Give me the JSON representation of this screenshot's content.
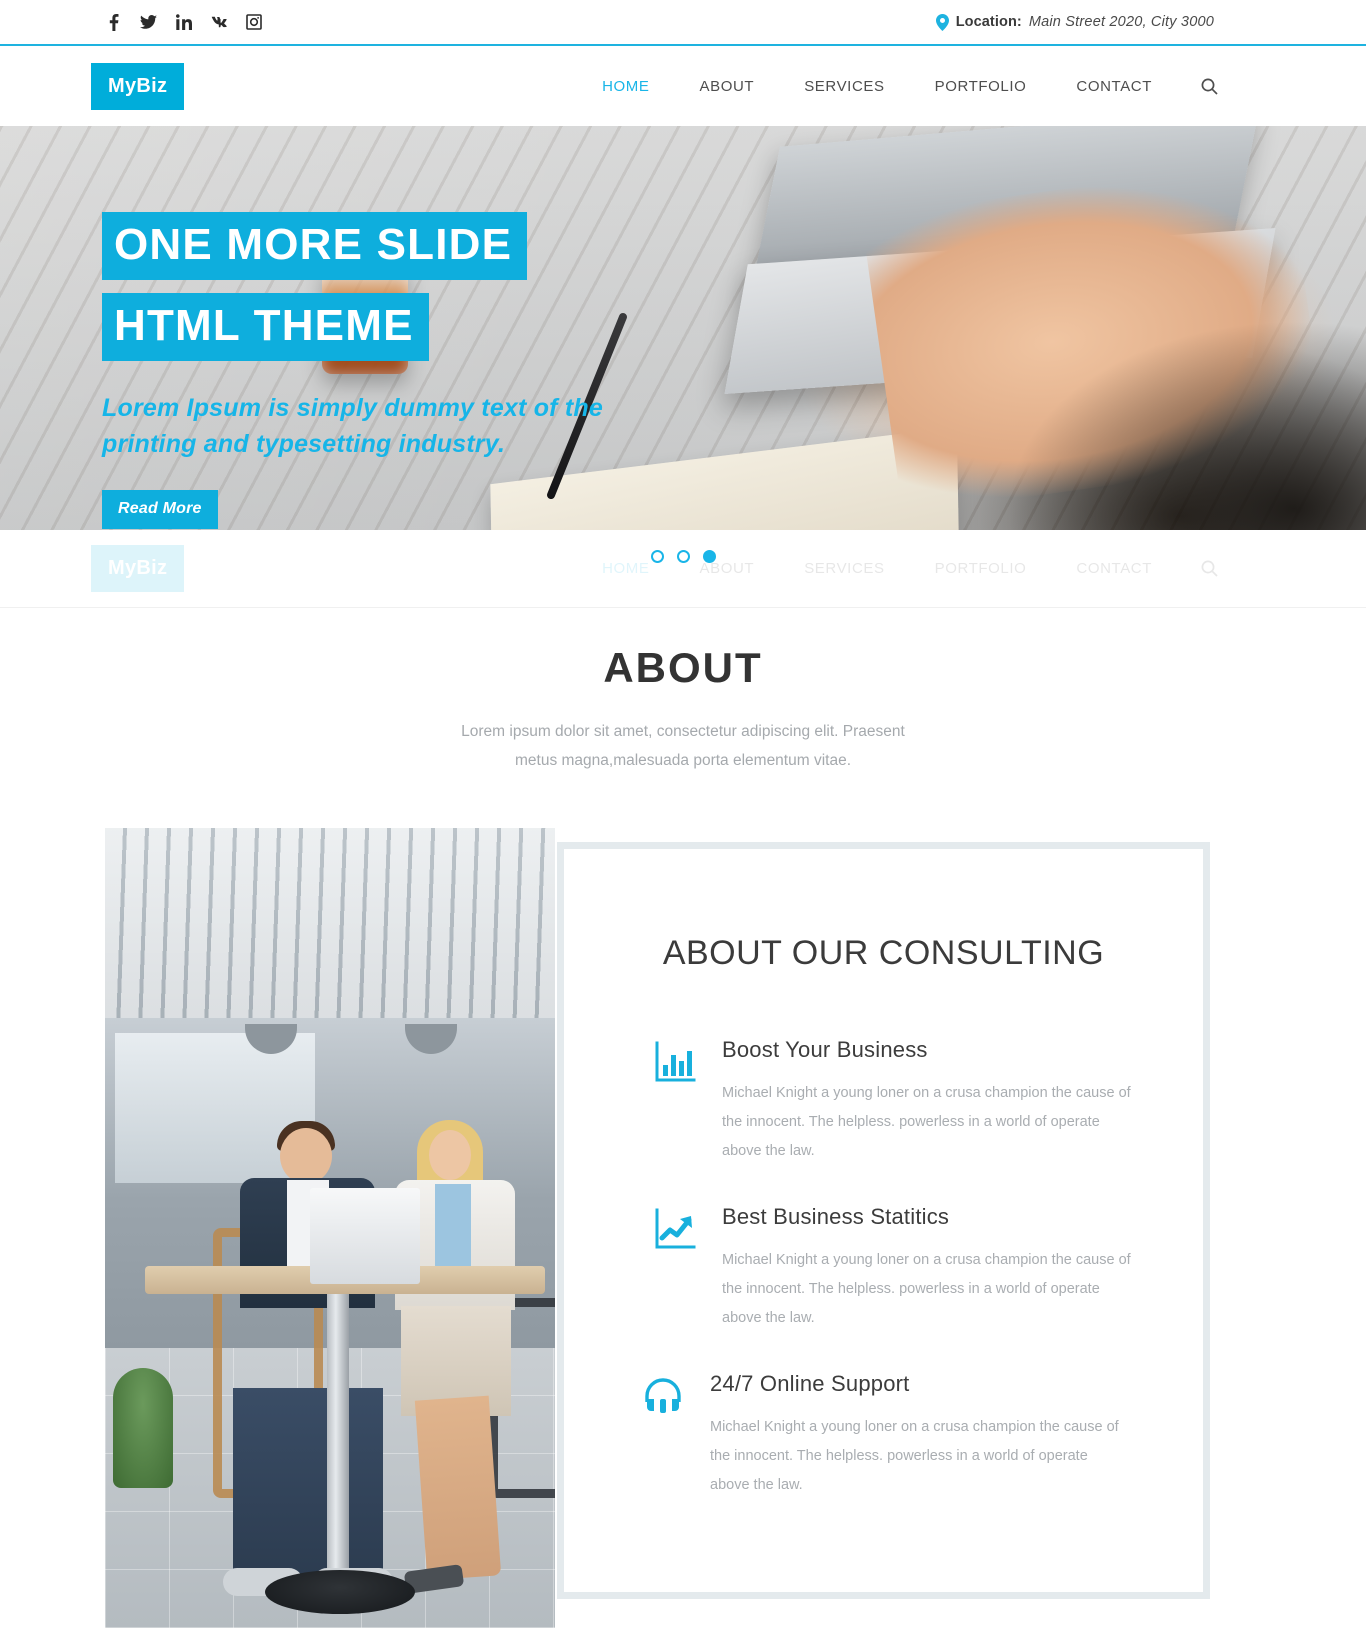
{
  "colors": {
    "accent": "#19b5e8",
    "logo_bg": "#00adda",
    "card_border": "#e4eaed",
    "body_text": "#a9adb1"
  },
  "topbar": {
    "social": [
      {
        "name": "facebook-icon",
        "label": "Facebook"
      },
      {
        "name": "twitter-icon",
        "label": "Twitter"
      },
      {
        "name": "linkedin-icon",
        "label": "LinkedIn"
      },
      {
        "name": "vk-icon",
        "label": "VK"
      },
      {
        "name": "instagram-icon",
        "label": "Instagram"
      }
    ],
    "location_label": "Location:",
    "location_value": "Main Street 2020, City 3000",
    "pin_icon": "map-pin-icon"
  },
  "header": {
    "logo": "MyBiz",
    "nav": [
      {
        "label": "HOME",
        "active": true
      },
      {
        "label": "ABOUT",
        "active": false
      },
      {
        "label": "SERVICES",
        "active": false
      },
      {
        "label": "PORTFOLIO",
        "active": false
      },
      {
        "label": "CONTACT",
        "active": false
      }
    ],
    "search_icon": "search-icon"
  },
  "hero": {
    "title_line1": "ONE MORE SLIDE",
    "title_line2": "HTML THEME",
    "subtitle": "Lorem Ipsum is simply dummy text of the printing and typesetting industry.",
    "button_label": "Read More",
    "slides": [
      {
        "index": 1,
        "active": false
      },
      {
        "index": 2,
        "active": false
      },
      {
        "index": 3,
        "active": true
      }
    ]
  },
  "about": {
    "title": "ABOUT",
    "subtitle": "Lorem ipsum dolor sit amet, consectetur adipiscing elit. Praesent metus magna,malesuada porta elementum vitae.",
    "card_title": "ABOUT OUR CONSULTING",
    "features": [
      {
        "icon": "bar-chart-icon",
        "title": "Boost Your Business",
        "text": "Michael Knight a young loner on a crusa champion the cause of the innocent. The helpless. powerless in a world of operate above the law."
      },
      {
        "icon": "trending-up-chart-icon",
        "title": "Best Business Statitics",
        "text": "Michael Knight a young loner on a crusa champion the cause of the innocent. The helpless. powerless in a world of operate above the law."
      },
      {
        "icon": "headphones-icon",
        "title": "24/7 Online Support",
        "text": "Michael Knight a young loner on a crusa champion the cause of the innocent. The helpless. powerless in a world of operate above the law."
      }
    ]
  }
}
